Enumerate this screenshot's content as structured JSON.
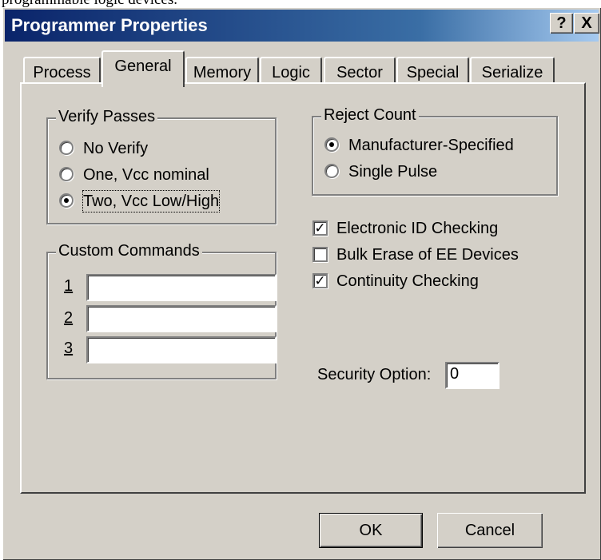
{
  "caption_fragment": "programmable logic devices.",
  "window": {
    "title": "Programmer Properties",
    "help_label": "?",
    "close_label": "X"
  },
  "tabs": [
    "Process",
    "General",
    "Memory",
    "Logic",
    "Sector",
    "Special",
    "Serialize"
  ],
  "active_tab": "General",
  "verify_passes": {
    "label": "Verify Passes",
    "options": [
      "No Verify",
      "One, Vcc nominal",
      "Two, Vcc Low/High"
    ],
    "selected": "Two, Vcc Low/High"
  },
  "reject_count": {
    "label": "Reject Count",
    "options": [
      "Manufacturer-Specified",
      "Single Pulse"
    ],
    "selected": "Manufacturer-Specified"
  },
  "checkboxes": [
    {
      "label": "Electronic ID Checking",
      "checked": true
    },
    {
      "label": "Bulk Erase of EE Devices",
      "checked": false
    },
    {
      "label": "Continuity Checking",
      "checked": true
    }
  ],
  "custom_commands": {
    "label": "Custom Commands",
    "items": [
      {
        "number": "1",
        "value": ""
      },
      {
        "number": "2",
        "value": ""
      },
      {
        "number": "3",
        "value": ""
      }
    ]
  },
  "security": {
    "label": "Security Option:",
    "value": "0"
  },
  "buttons": {
    "ok": "OK",
    "cancel": "Cancel"
  }
}
